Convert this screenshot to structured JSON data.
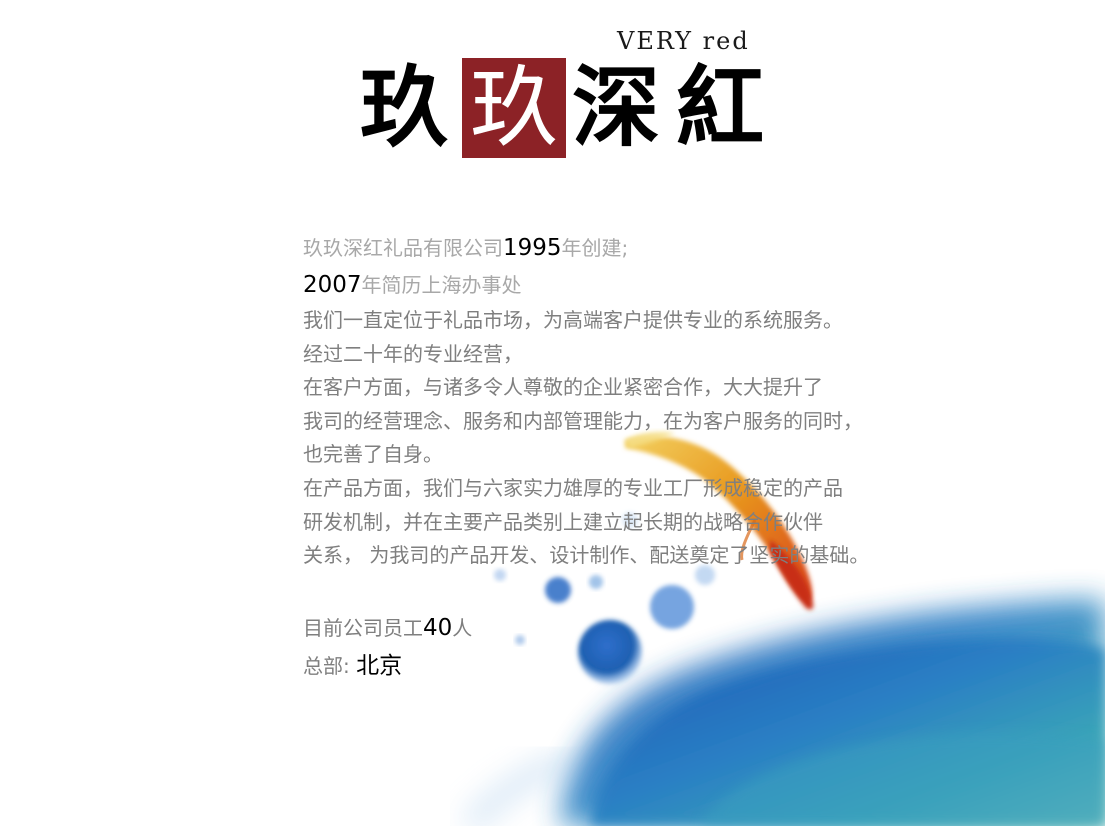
{
  "logo": {
    "english": "VERY red",
    "chars": [
      "玖",
      "玖",
      "深",
      "紅"
    ],
    "accent_color": "#8c2226"
  },
  "intro": {
    "line1_prefix": "玖玖深红礼品有限公司",
    "line1_year": "1995",
    "line1_suffix": "年创建;",
    "line2_year": "2007",
    "line2_suffix": "年简历上海办事处"
  },
  "paragraphs": [
    "我们一直定位于礼品市场，为高端客户提供专业的系统服务。",
    "经过二十年的专业经营，",
    "在客户方面，与诸多令人尊敬的企业紧密合作，大大提升了",
    "我司的经营理念、服务和内部管理能力，在为客户服务的同时，",
    "也完善了自身。",
    "在产品方面，我们与六家实力雄厚的专业工厂形成稳定的产品",
    "研发机制，并在主要产品类别上建立起长期的战略合作伙伴",
    "关系，  为我司的产品开发、设计制作、配送奠定了坚实的基础。"
  ],
  "staff": {
    "prefix": "目前公司员工",
    "count": "40",
    "suffix": "人"
  },
  "hq": {
    "label": "总部: ",
    "city": "北京"
  },
  "colors": {
    "ink_blue": "#1d5fb0",
    "teal": "#3aa0b0",
    "fish_orange": "#e85a1a",
    "fish_gold": "#e8b020",
    "text_gray": "#7f7f7f"
  }
}
